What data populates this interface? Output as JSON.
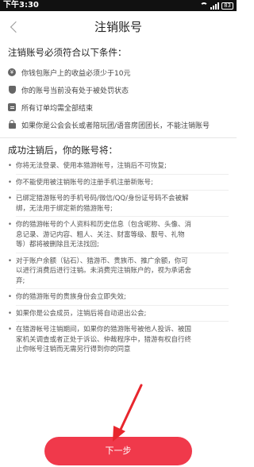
{
  "status_bar": {
    "time": "下午3:30",
    "battery": "83"
  },
  "nav": {
    "title": "注销账号"
  },
  "conditions": {
    "title": "注销账号必须符合以下条件：",
    "items": [
      {
        "icon": "money-icon",
        "text": "你钱包账户上的收益必须少于10元"
      },
      {
        "icon": "shield-icon",
        "text": "你的账号当前没有处于被处罚状态"
      },
      {
        "icon": "order-icon",
        "text": "所有订单均需全部结束"
      },
      {
        "icon": "lock-icon",
        "text": "如果你是公会会长或者陪玩团/语音房团团长，不能注销账号"
      }
    ]
  },
  "consequences": {
    "title": "成功注销后，你的账号将：",
    "items": [
      {
        "lines": [
          "你将无法登录、使用本猎游帐号，注销后不可恢复;"
        ]
      },
      {
        "lines": [
          "你不能使用被注销账号的注册手机注册新账号;"
        ]
      },
      {
        "lines": [
          "已绑定猎游账号的手机号码/微信/QQ/身份证号码不会被解",
          "绑，无法用于绑定新的猎游账号;"
        ]
      },
      {
        "lines": [
          "你的猎游帐号的个人资料和历史信息（包含昵称、头像、消",
          "息记录、游记内容、粗人、关注、财富等级、靓号、礼物",
          "等）都将被删除且无法找回;"
        ]
      },
      {
        "lines": [
          "对于账户余额（钻石）、猎游币、贵族币、推广余额，你可",
          "以进行消费后进行注销。未消费完注销账户的，视为承诺舍",
          "弃;"
        ]
      },
      {
        "lines": [
          "你的猎游账号的贵族身份会立即失效;"
        ]
      },
      {
        "lines": [
          "如果你是公会成员，注销后将自动退出公会;"
        ]
      },
      {
        "lines": [
          "在猎游帐号注销期间，如果你的猎游账号被他人投诉、被国",
          "家机关调查或者正处于诉讼、仲裁程序中，猎游有权自行终",
          "止你帐号注销而无需另行得到你的同意"
        ]
      }
    ]
  },
  "actions": {
    "next_label": "下一步"
  },
  "colors": {
    "accent": "#f0394b",
    "annotation_arrow": "#e8262d"
  }
}
